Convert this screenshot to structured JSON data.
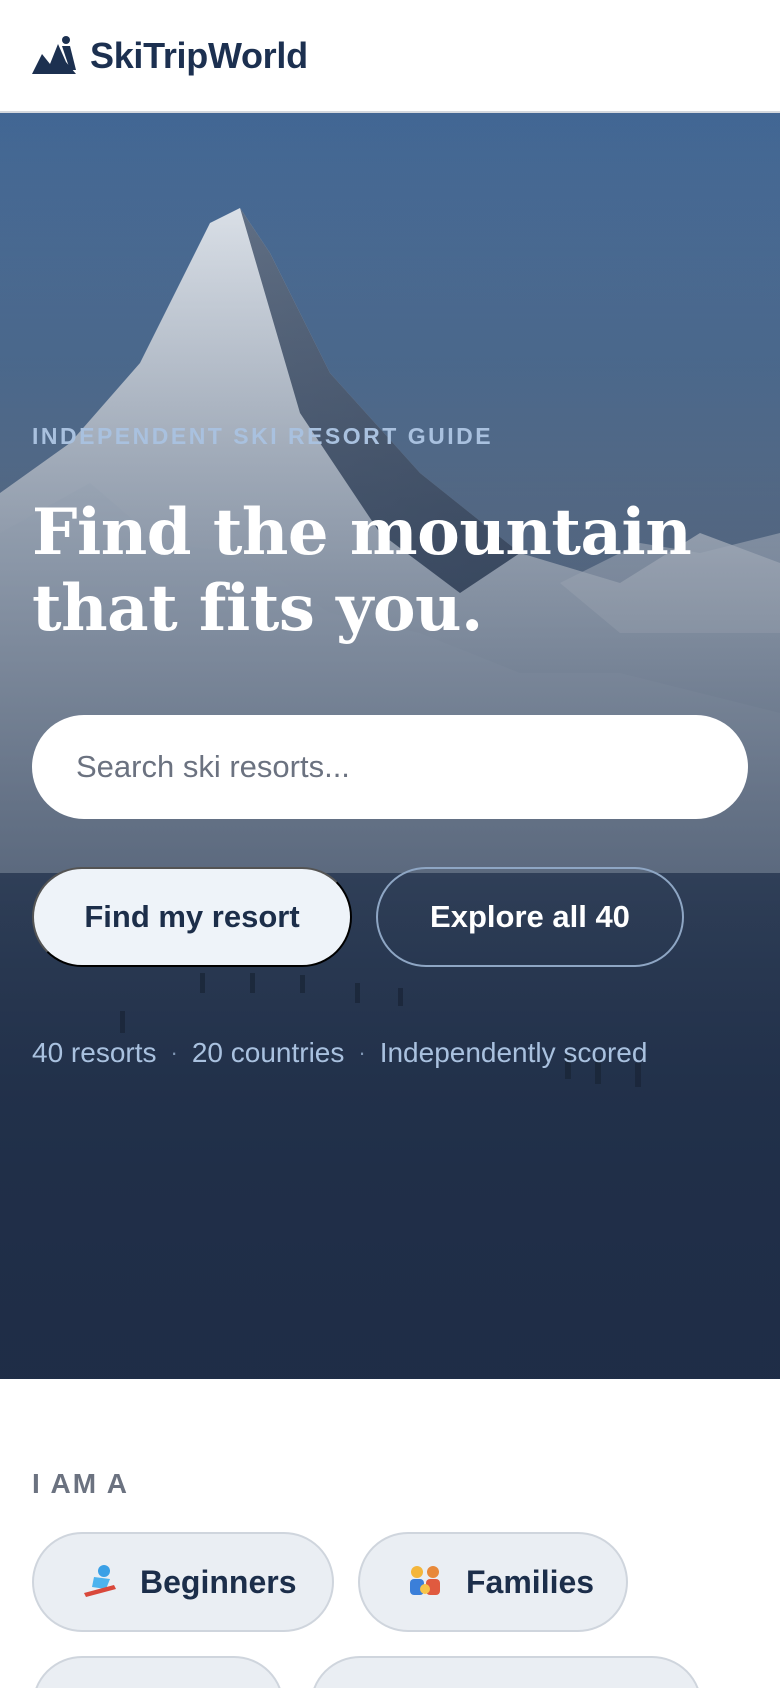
{
  "header": {
    "brand": "SkiTripWorld",
    "logo_icon": "skier-logo-icon"
  },
  "hero": {
    "eyebrow": "INDEPENDENT SKI RESORT GUIDE",
    "headline_line1": "Find the mountain",
    "headline_line2": "that fits you.",
    "search_placeholder": "Search ski resorts...",
    "primary_button": "Find my resort",
    "secondary_button": "Explore all 40",
    "stats": [
      "40 resorts",
      "20 countries",
      "Independently scored"
    ],
    "stats_separator": "·"
  },
  "persona": {
    "label": "I AM A",
    "chips": [
      {
        "label": "Beginners",
        "icon": "sledding-icon"
      },
      {
        "label": "Families",
        "icon": "family-icon"
      }
    ]
  },
  "colors": {
    "brand": "#1c3050",
    "eyebrow": "#a9c1df",
    "hero_dark": "#203048"
  }
}
